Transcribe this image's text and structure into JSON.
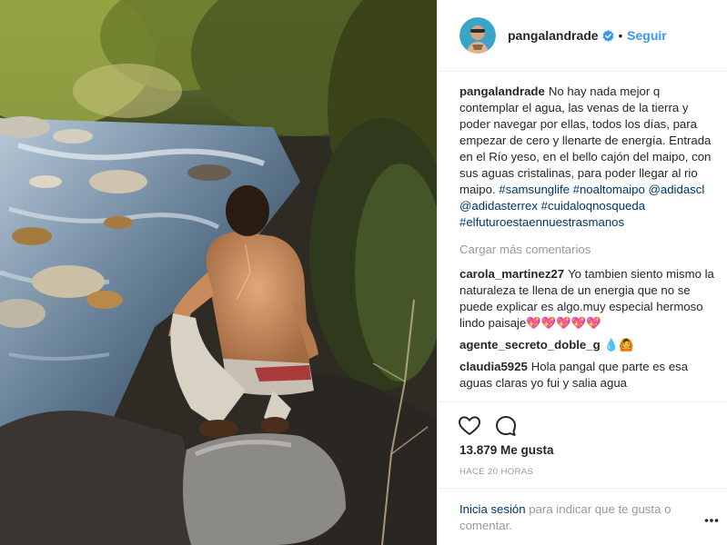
{
  "photo": {
    "description_icon": "post-photo"
  },
  "header": {
    "username": "pangalandrade",
    "separator": "•",
    "follow_label": "Seguir"
  },
  "caption": {
    "username": "pangalandrade",
    "text": "No hay nada mejor q contemplar el agua, las venas de la tierra y poder navegar por ellas, todos los días, para empezar de cero y llenarte de energía. Entrada en el Río yeso, en el bello cajón del maipo, con sus aguas cristalinas, para poder llegar al rio maipo.",
    "hashtags": [
      "#samsunglife",
      "#noaltomaipo",
      "@adidascl",
      "@adidasterrex",
      "#cuidaloqnosqueda",
      "#elfuturoestaennuestrasmanos"
    ]
  },
  "load_more_label": "Cargar más comentarios",
  "comments": [
    {
      "user": "carola_martinez27",
      "text": "Yo tambien siento mismo la naturaleza te llena de un energia que no se puede explicar es algo.muy especial hermoso lindo paisaje💖💖💖💖💖"
    },
    {
      "user": "agente_secreto_doble_g",
      "text": "💧🙆"
    },
    {
      "user": "claudia5925",
      "text": "Hola pangal que parte es esa aguas claras yo fui y salia agua"
    }
  ],
  "actions": {
    "like_icon": "heart-icon",
    "comment_icon": "comment-icon"
  },
  "likes_label": "13.879 Me gusta",
  "time_label": "HACE 20 HORAS",
  "login": {
    "link": "Inicia sesión",
    "text": " para indicar que te gusta o comentar."
  },
  "more_icon": "ellipsis-icon",
  "colors": {
    "link": "#003569",
    "follow": "#3897f0",
    "muted": "#999999",
    "text": "#262626",
    "verified": "#3897f0"
  }
}
